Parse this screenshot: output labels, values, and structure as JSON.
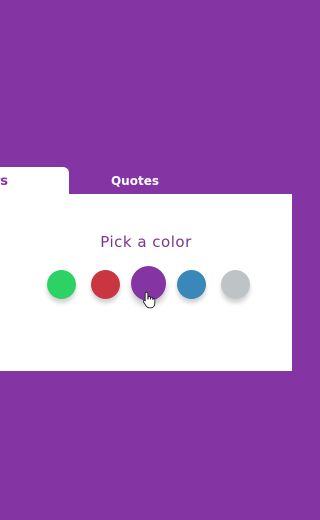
{
  "tabs": [
    {
      "label": "Colors",
      "active": true
    },
    {
      "label": "Quotes",
      "active": false
    }
  ],
  "panel": {
    "title": "Pick a color"
  },
  "swatches": [
    {
      "name": "green",
      "color": "#2ed164"
    },
    {
      "name": "red",
      "color": "#c93642"
    },
    {
      "name": "purple",
      "color": "#8534a3",
      "selected": true
    },
    {
      "name": "blue",
      "color": "#3a87b9"
    },
    {
      "name": "gray",
      "color": "#bec4c6"
    }
  ],
  "colors": {
    "background": "#8534a3",
    "panel": "#ffffff",
    "title_text": "#7a3590"
  },
  "icons": {
    "cursor": "hand-pointer-icon"
  }
}
